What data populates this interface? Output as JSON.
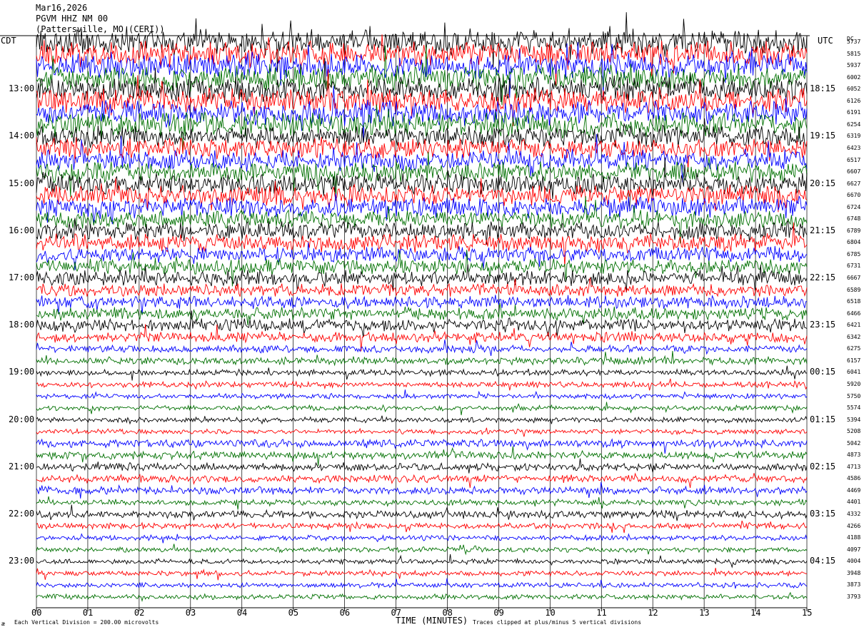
{
  "header": {
    "date": "Mar16,2026",
    "station": "PGVM HHZ NM 00",
    "location": "(Pattersville, MO (CERI))"
  },
  "labels": {
    "left_zone": "CDT",
    "right_zone": "UTC",
    "dc_header": "DC",
    "x_axis_title": "TIME (MINUTES)",
    "footer_left_mark": "æ",
    "footer_scale": "Each Vertical Division =  200.00 microvolts",
    "footer_clip": "Traces clipped at plus/minus 5 vertical divisions"
  },
  "colors": {
    "trace_cycle": [
      "#000000",
      "#ff0000",
      "#0000ff",
      "#007000"
    ],
    "gridline": "#000000",
    "background": "#ffffff"
  },
  "chart_data": {
    "type": "line",
    "title": "PGVM HHZ NM 00",
    "xlabel": "TIME (MINUTES)",
    "x_ticks": [
      "00",
      "01",
      "02",
      "03",
      "04",
      "05",
      "06",
      "07",
      "08",
      "09",
      "10",
      "11",
      "12",
      "13",
      "14",
      "15"
    ],
    "xlim": [
      0,
      15
    ],
    "trace_minutes": 15,
    "traces_per_hour": 4,
    "trace_count": 48,
    "left_hour_labels": [
      "13:00",
      "14:00",
      "15:00",
      "16:00",
      "17:00",
      "18:00",
      "19:00",
      "20:00",
      "21:00",
      "22:00",
      "23:00"
    ],
    "left_first_labeled_trace": 4,
    "right_time_labels": [
      "18:15",
      "19:15",
      "20:15",
      "21:15",
      "22:15",
      "23:15",
      "00:15",
      "01:15",
      "02:15",
      "03:15",
      "04:15"
    ],
    "right_first_labeled_trace": 4,
    "dc_offsets": [
      "5737",
      "5815",
      "5937",
      "6002",
      "6052",
      "6126",
      "6191",
      "6254",
      "6319",
      "6423",
      "6517",
      "6607",
      "6627",
      "6670",
      "6724",
      "6748",
      "6789",
      "6804",
      "6785",
      "6731",
      "6667",
      "6589",
      "6518",
      "6466",
      "6421",
      "6342",
      "6275",
      "6157",
      "6041",
      "5920",
      "5750",
      "5574",
      "5394",
      "5208",
      "5042",
      "4873",
      "4713",
      "4586",
      "4469",
      "4401",
      "4332",
      "4266",
      "4188",
      "4097",
      "4004",
      "3948",
      "3873",
      "3793"
    ],
    "amplitude_divisions": [
      5,
      5,
      5,
      5,
      5,
      5,
      5,
      5,
      4,
      4,
      4,
      4,
      4,
      4,
      4,
      3.5,
      3.5,
      3.5,
      3,
      3,
      3,
      2.5,
      2.5,
      2.5,
      2.5,
      2,
      1.5,
      1.5,
      1.2,
      1.2,
      1,
      1,
      1,
      1,
      1.5,
      1.5,
      1.5,
      1.5,
      1.5,
      1.2,
      1.5,
      1.2,
      1,
      1,
      1,
      1,
      1,
      1
    ],
    "clip_divisions": 5,
    "vertical_division_microvolts": 200.0
  }
}
